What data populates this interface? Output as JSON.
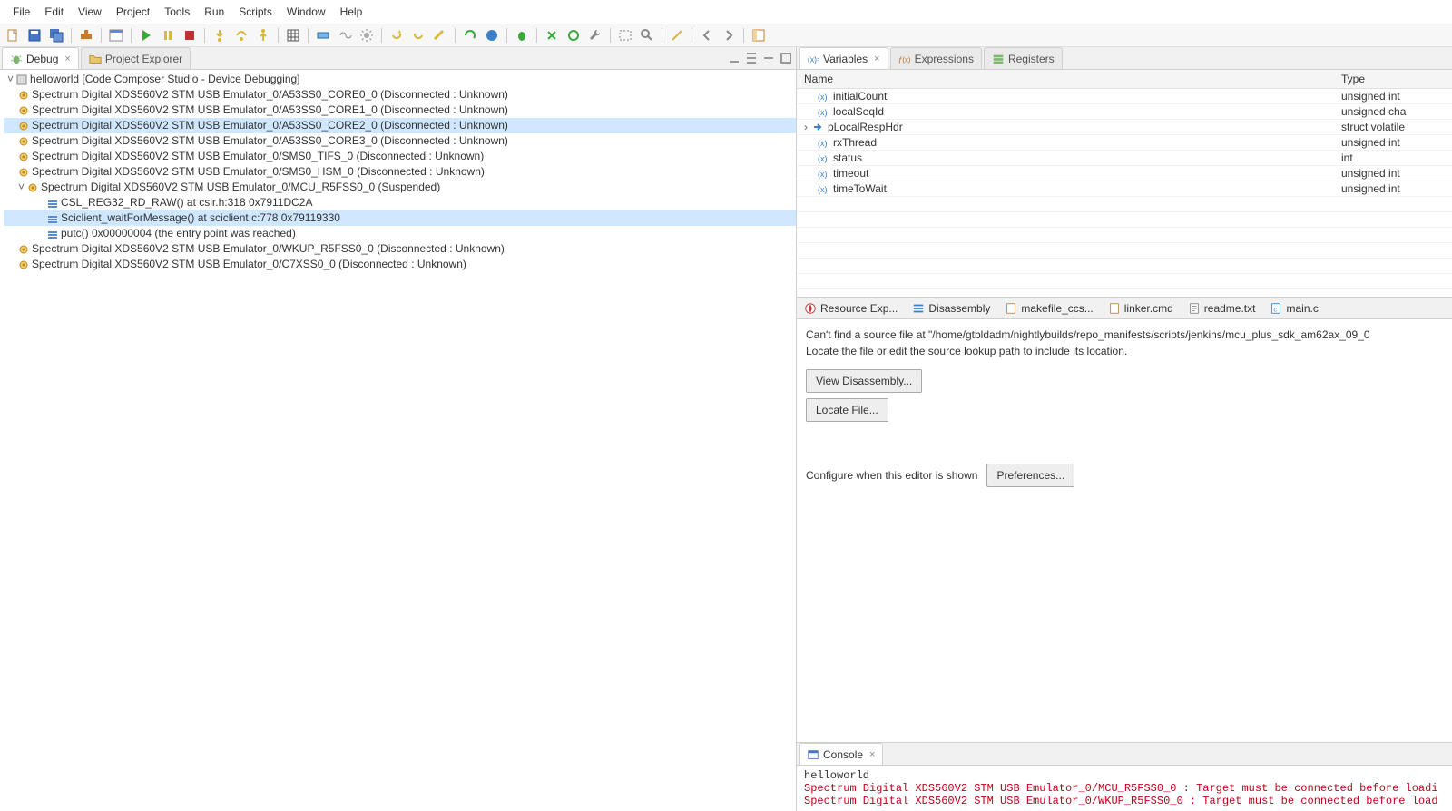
{
  "menu": [
    "File",
    "Edit",
    "View",
    "Project",
    "Tools",
    "Run",
    "Scripts",
    "Window",
    "Help"
  ],
  "leftTabs": {
    "debug": "Debug",
    "projExp": "Project Explorer"
  },
  "tree": {
    "root": "helloworld [Code Composer Studio - Device Debugging]",
    "cores": [
      "Spectrum Digital XDS560V2 STM USB Emulator_0/A53SS0_CORE0_0 (Disconnected : Unknown)",
      "Spectrum Digital XDS560V2 STM USB Emulator_0/A53SS0_CORE1_0 (Disconnected : Unknown)",
      "Spectrum Digital XDS560V2 STM USB Emulator_0/A53SS0_CORE2_0 (Disconnected : Unknown)",
      "Spectrum Digital XDS560V2 STM USB Emulator_0/A53SS0_CORE3_0 (Disconnected : Unknown)",
      "Spectrum Digital XDS560V2 STM USB Emulator_0/SMS0_TIFS_0 (Disconnected : Unknown)",
      "Spectrum Digital XDS560V2 STM USB Emulator_0/SMS0_HSM_0 (Disconnected : Unknown)"
    ],
    "suspended": "Spectrum Digital XDS560V2 STM USB Emulator_0/MCU_R5FSS0_0 (Suspended)",
    "frames": [
      "CSL_REG32_RD_RAW() at cslr.h:318 0x7911DC2A",
      "Sciclient_waitForMessage() at sciclient.c:778 0x79119330",
      "putc() 0x00000004  (the entry point was reached)"
    ],
    "more": [
      "Spectrum Digital XDS560V2 STM USB Emulator_0/WKUP_R5FSS0_0 (Disconnected : Unknown)",
      "Spectrum Digital XDS560V2 STM USB Emulator_0/C7XSS0_0 (Disconnected : Unknown)"
    ]
  },
  "varTabs": {
    "variables": "Variables",
    "expressions": "Expressions",
    "registers": "Registers"
  },
  "varHeaders": {
    "name": "Name",
    "type": "Type"
  },
  "vars": [
    {
      "name": "initialCount",
      "type": "unsigned int"
    },
    {
      "name": "localSeqId",
      "type": "unsigned cha"
    },
    {
      "name": "pLocalRespHdr",
      "type": "struct volatile",
      "ptr": true
    },
    {
      "name": "rxThread",
      "type": "unsigned int"
    },
    {
      "name": "status",
      "type": "int"
    },
    {
      "name": "timeout",
      "type": "unsigned int"
    },
    {
      "name": "timeToWait",
      "type": "unsigned int"
    }
  ],
  "editorTabs": {
    "resource": "Resource Exp...",
    "disasm": "Disassembly",
    "makefile": "makefile_ccs...",
    "linker": "linker.cmd",
    "readme": "readme.txt",
    "main": "main.c"
  },
  "editor": {
    "msg1": "Can't find a source file at \"/home/gtbldadm/nightlybuilds/repo_manifests/scripts/jenkins/mcu_plus_sdk_am62ax_09_0",
    "msg2": "Locate the file or edit the source lookup path to include its location.",
    "btn1": "View Disassembly...",
    "btn2": "Locate File...",
    "cfg": "Configure when this editor is shown",
    "pref": "Preferences..."
  },
  "consoleTab": "Console",
  "console": {
    "title": "helloworld",
    "line1": "Spectrum Digital XDS560V2 STM USB Emulator_0/MCU_R5FSS0_0 : Target must be connected before loadi",
    "line2": "Spectrum Digital XDS560V2 STM USB Emulator_0/WKUP_R5FSS0_0 : Target must be connected before load"
  }
}
